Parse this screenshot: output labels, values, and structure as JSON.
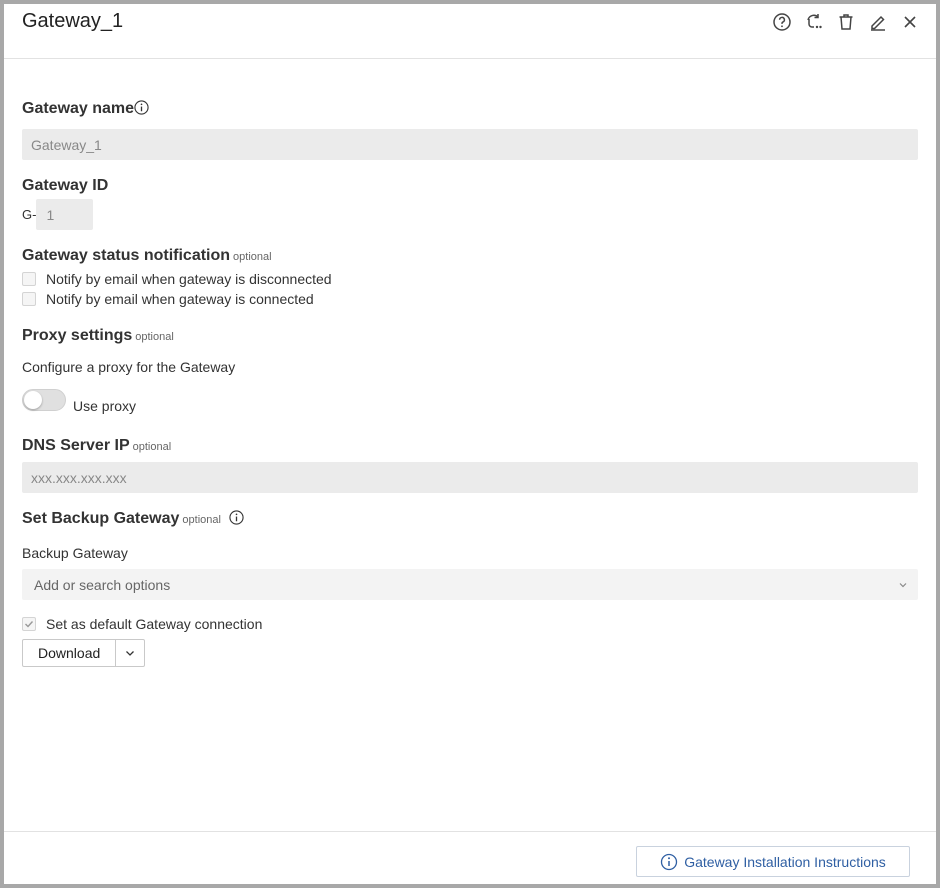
{
  "header": {
    "title": "Gateway_1",
    "icons": [
      "help-icon",
      "sync-icon",
      "trash-icon",
      "edit-icon",
      "close-icon"
    ]
  },
  "gateway_name": {
    "label": "Gateway name",
    "value": "Gateway_1"
  },
  "gateway_id": {
    "label": "Gateway ID",
    "prefix": "G-",
    "value": "1"
  },
  "status_notification": {
    "label": "Gateway status notification",
    "optional": "optional",
    "options": [
      {
        "label": "Notify by email when gateway is disconnected",
        "checked": false
      },
      {
        "label": "Notify by email when gateway is connected",
        "checked": false
      }
    ]
  },
  "proxy": {
    "label": "Proxy settings",
    "optional": "optional",
    "description": "Configure a proxy for the Gateway",
    "toggle_label": "Use proxy",
    "enabled": false
  },
  "dns": {
    "label": "DNS Server IP",
    "optional": "optional",
    "placeholder": "xxx.xxx.xxx.xxx"
  },
  "backup": {
    "label": "Set Backup Gateway",
    "optional": "optional",
    "field_label": "Backup Gateway",
    "placeholder": "Add or search options",
    "default_label": "Set as default Gateway connection",
    "default_checked": true
  },
  "download": {
    "label": "Download"
  },
  "footer": {
    "install_label": "Gateway Installation Instructions"
  },
  "colors": {
    "accent": "#2f5fa3",
    "field_bg": "#ebebeb",
    "border": "#a8a8a8"
  }
}
